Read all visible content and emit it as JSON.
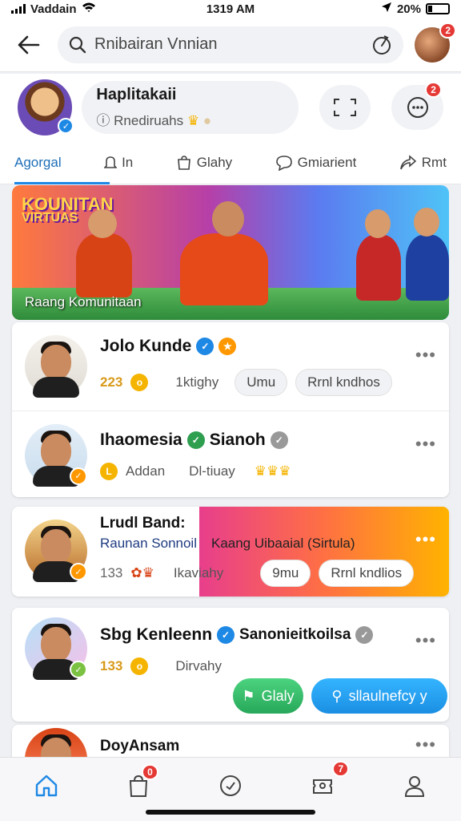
{
  "status_bar": {
    "carrier": "Vaddain",
    "time": "1319 AM",
    "battery": "20%"
  },
  "search": {
    "value": "Rnibairan Vnnian"
  },
  "top_avatar_badge": "2",
  "profile": {
    "name": "Haplitakaii",
    "subtitle": "Rnediruahs",
    "notif_badge": "2"
  },
  "tabs": [
    {
      "label": "Agorgal"
    },
    {
      "label": "In"
    },
    {
      "label": "Glahy"
    },
    {
      "label": "Gmiarient"
    },
    {
      "label": "Rmt"
    }
  ],
  "banner": {
    "logo_line1": "KOUNITAN",
    "logo_line2": "VIRTUAS",
    "caption": "Raang Komunitaan"
  },
  "users": [
    {
      "name": "Jolo Kunde",
      "score": "223",
      "meta": "1ktighy",
      "chip1": "Umu",
      "chip2": "Rrnl kndhos"
    },
    {
      "name": "Ihaomesia",
      "name_extra": "Sianoh",
      "coin_label": "Addan",
      "meta": "Dl-tiuay"
    },
    {
      "name": "Lrudl Band:",
      "overlay_sub_left": "Raunan Sonnoil",
      "overlay_text": "Kaang Uibaaial (Sirtula)",
      "score": "133",
      "meta": "Ikaviahy",
      "chip1": "9mu",
      "chip2": "Rrnl kndlios"
    },
    {
      "name": "Sbg Kenleenn",
      "name_extra": "Sanonieitkoilsa",
      "score": "133",
      "meta": "Dirvahy",
      "btn_green": "Glaly",
      "btn_blue": "sllaulnefcy y"
    },
    {
      "name": "DoyAnsam"
    }
  ],
  "bottom_nav": {
    "badge_bag": "0",
    "badge_ticket": "7"
  },
  "colors": {
    "accent": "#1e88e5",
    "badge": "#e53935",
    "gold": "#f5b400"
  }
}
